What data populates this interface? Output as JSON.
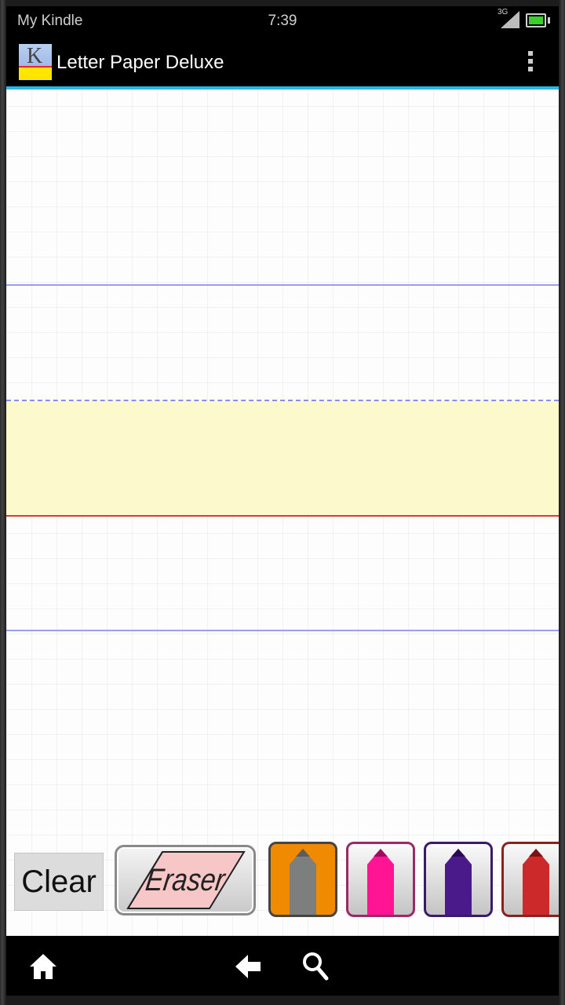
{
  "status_bar": {
    "app_name": "My Kindle",
    "time": "7:39",
    "network_label": "3G",
    "icons": [
      "signal-icon",
      "battery-icon"
    ],
    "battery_color": "#39d02a"
  },
  "action_bar": {
    "title": "Letter Paper Deluxe",
    "icons": [
      "app-icon",
      "overflow-menu-icon"
    ],
    "underline_color": "#2bb7e6"
  },
  "paper": {
    "colors": {
      "guide_blue": "#9a9ef0",
      "baseline_red": "#e0363a",
      "highlight": "#fcfacc"
    }
  },
  "toolbar": {
    "clear_label": "Clear",
    "eraser_label": "Eraser",
    "pens": [
      {
        "name": "pen-gray",
        "color": "#7c7f7d",
        "frame": "#f08a00",
        "selected": true
      },
      {
        "name": "pen-pink",
        "color": "#ff1493",
        "frame": "#9a2a66",
        "selected": false
      },
      {
        "name": "pen-purple",
        "color": "#4b1a8a",
        "frame": "#3a1a6a",
        "selected": false
      },
      {
        "name": "pen-red",
        "color": "#cc2a2a",
        "frame": "#8a2020",
        "selected": false
      }
    ]
  },
  "nav_bar": {
    "icons": [
      "home-icon",
      "back-icon",
      "search-icon"
    ]
  }
}
